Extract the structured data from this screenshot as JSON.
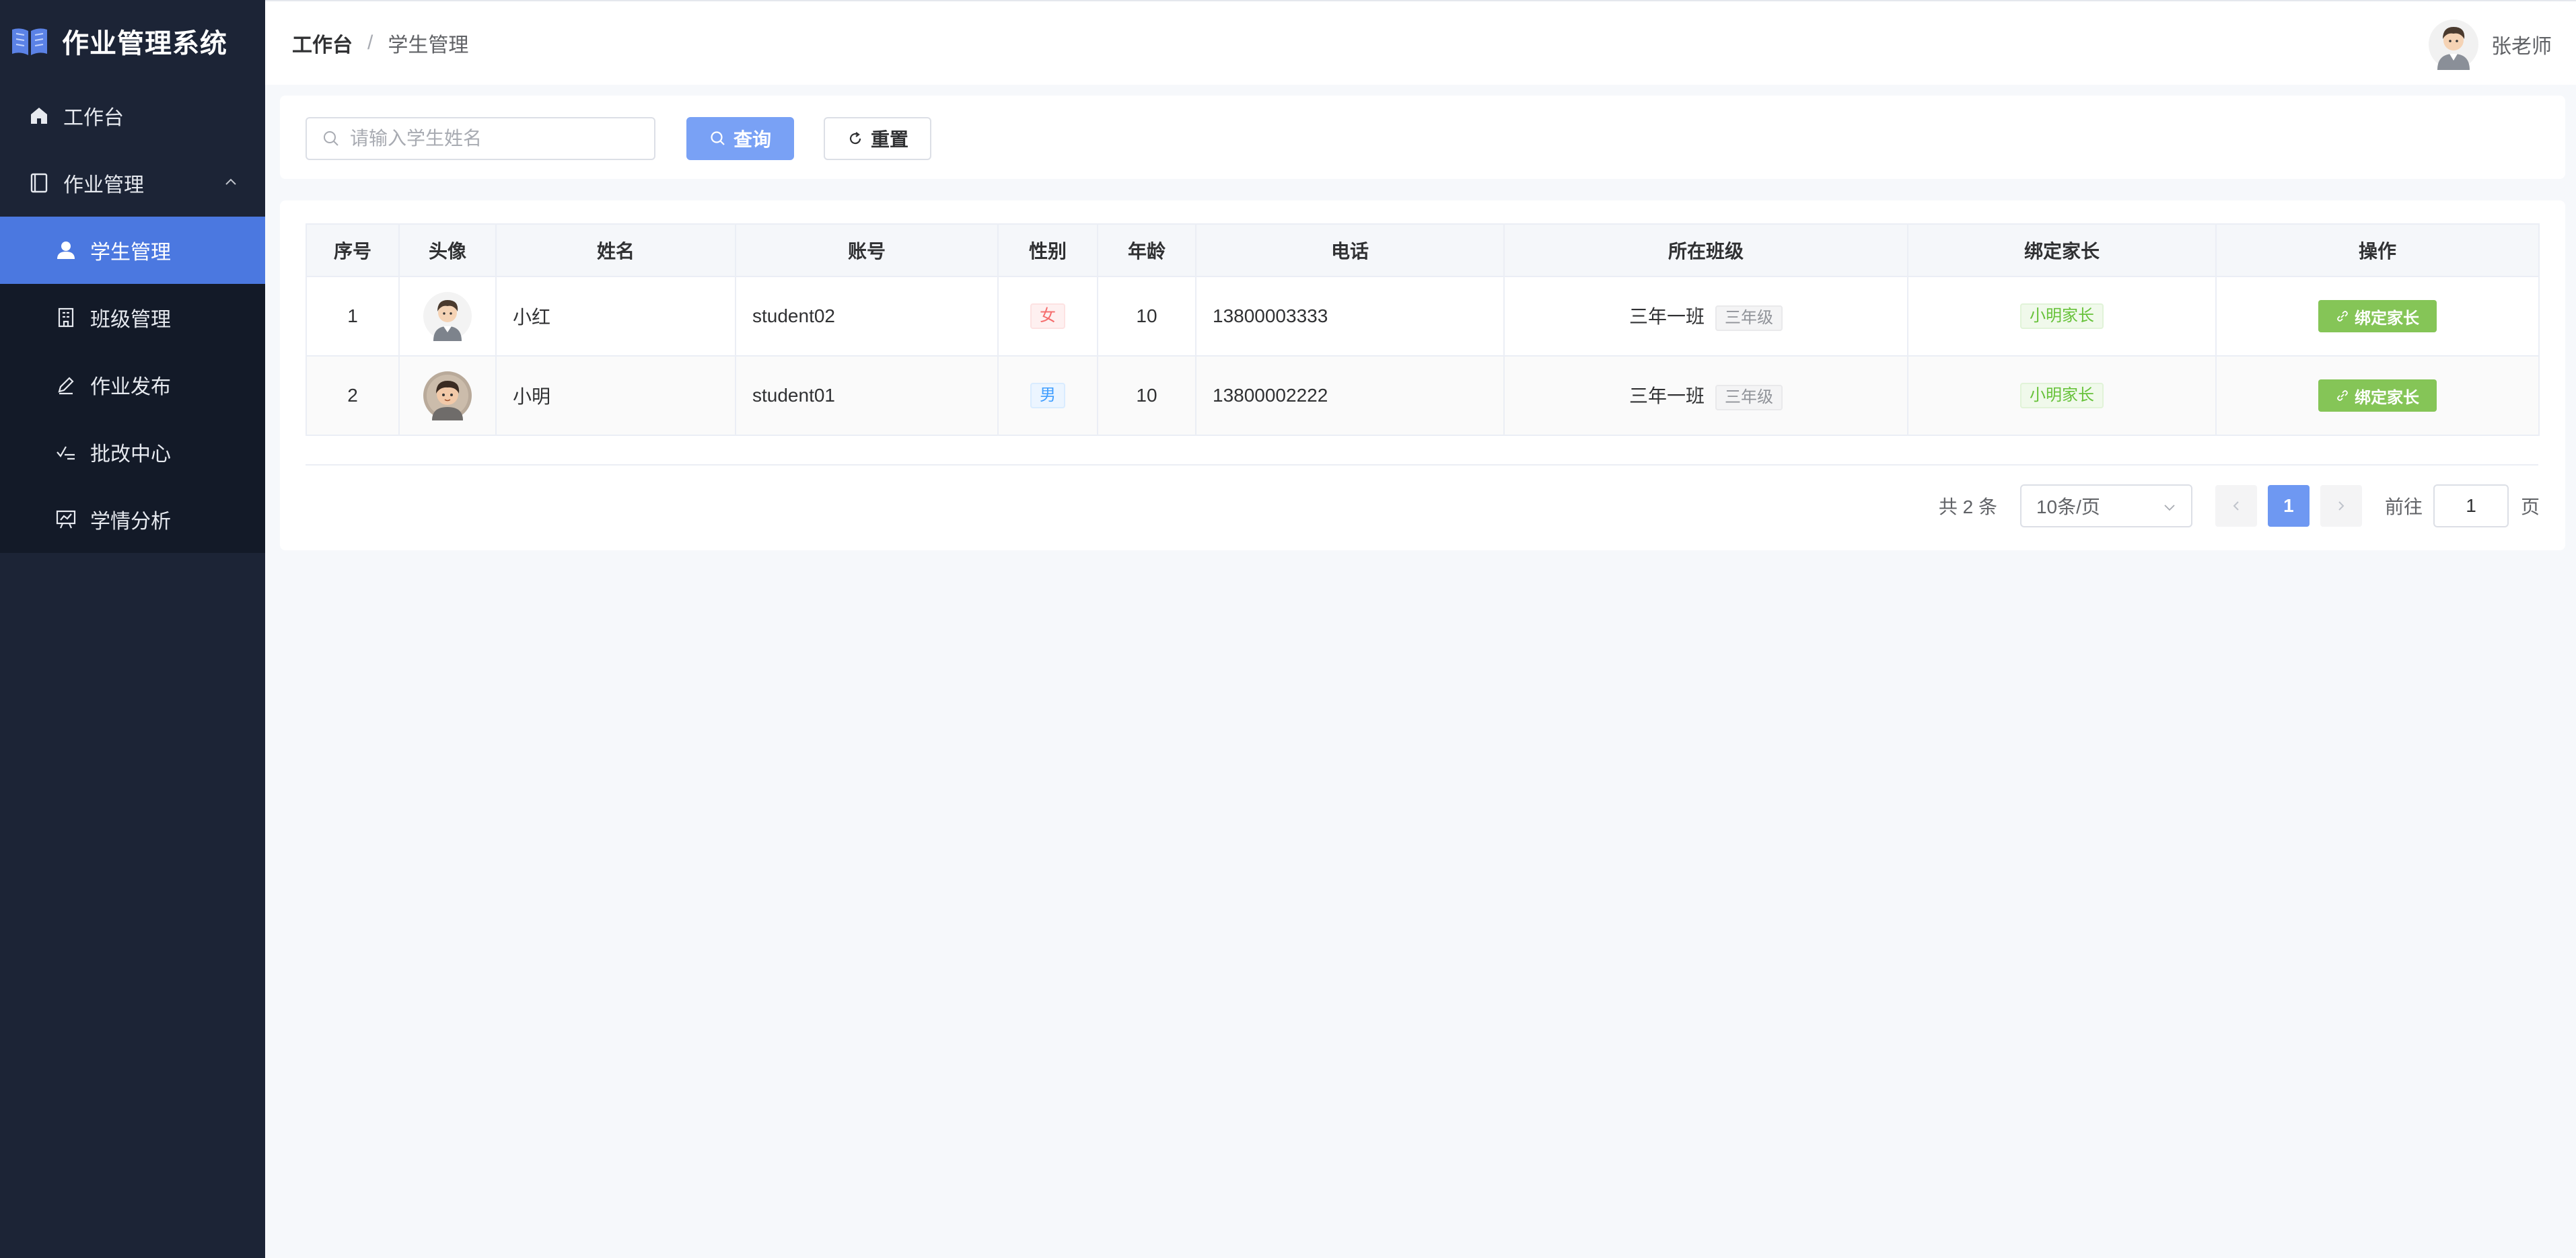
{
  "app": {
    "title": "作业管理系统"
  },
  "sidebar": {
    "items": [
      {
        "label": "工作台",
        "icon": "home-icon"
      },
      {
        "label": "作业管理",
        "icon": "notebook-icon",
        "expanded": true,
        "children": [
          {
            "label": "学生管理",
            "icon": "user-icon",
            "active": true
          },
          {
            "label": "班级管理",
            "icon": "building-icon"
          },
          {
            "label": "作业发布",
            "icon": "edit-icon"
          },
          {
            "label": "批改中心",
            "icon": "check-list-icon"
          },
          {
            "label": "学情分析",
            "icon": "chart-board-icon"
          }
        ]
      }
    ]
  },
  "header": {
    "breadcrumb_root": "工作台",
    "breadcrumb_sep": "/",
    "breadcrumb_current": "学生管理",
    "user_name": "张老师"
  },
  "search": {
    "placeholder": "请输入学生姓名",
    "value": "",
    "query_label": "查询",
    "reset_label": "重置"
  },
  "table": {
    "columns": [
      "序号",
      "头像",
      "姓名",
      "账号",
      "性别",
      "年龄",
      "电话",
      "所在班级",
      "绑定家长",
      "操作"
    ],
    "rows": [
      {
        "index": "1",
        "name": "小红",
        "account": "student02",
        "gender": "女",
        "age": "10",
        "phone": "13800003333",
        "class": "三年一班",
        "grade": "三年级",
        "parent": "小明家长",
        "action": "绑定家长"
      },
      {
        "index": "2",
        "name": "小明",
        "account": "student01",
        "gender": "男",
        "age": "10",
        "phone": "13800002222",
        "class": "三年一班",
        "grade": "三年级",
        "parent": "小明家长",
        "action": "绑定家长"
      }
    ]
  },
  "pagination": {
    "total_text": "共 2 条",
    "page_size": "10条/页",
    "current_page": "1",
    "goto_label": "前往",
    "goto_value": "1",
    "page_unit": "页"
  },
  "colors": {
    "sidebar_bg": "#1c2436",
    "active": "#4b78e0",
    "primary_btn": "#79a1f5",
    "bind_btn": "#85c557"
  }
}
